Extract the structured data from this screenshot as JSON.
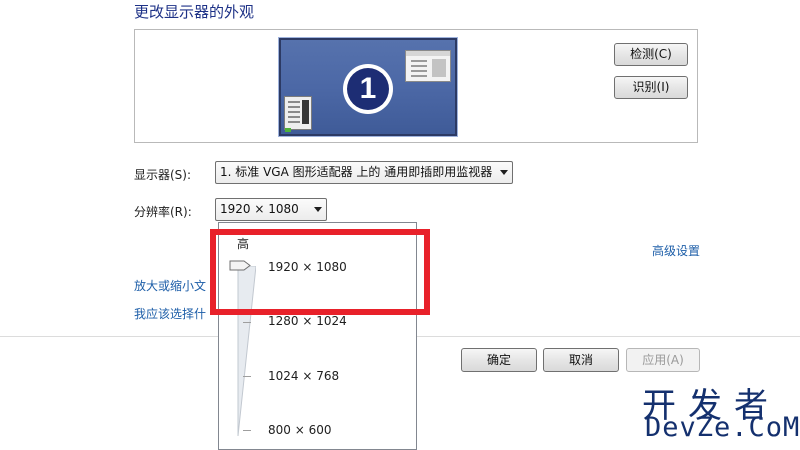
{
  "header": {
    "title": "更改显示器的外观"
  },
  "preview": {
    "monitor_number": "1",
    "detect_button": "检测(C)",
    "identify_button": "识别(I)"
  },
  "settings": {
    "display_label": "显示器(S):",
    "display_value": "1. 标准 VGA 图形适配器 上的 通用即插即用监视器",
    "resolution_label": "分辨率(R):",
    "resolution_value": "1920 × 1080",
    "advanced_link": "高级设置",
    "zoom_link": "放大或缩小文",
    "which_link": "我应该选择什"
  },
  "resolution_dropdown": {
    "high_label": "高",
    "options": [
      "1920 × 1080",
      "1280 × 1024",
      "1024 × 768",
      "800 × 600"
    ],
    "selected": "1920 × 1080"
  },
  "footer": {
    "ok_button": "确定",
    "cancel_button": "取消",
    "apply_button": "应用(A)"
  },
  "watermark": {
    "line1": "开发者",
    "line2": "DevZe.CoM"
  },
  "colors": {
    "highlight": "#e8212a",
    "link": "#1d5ea8",
    "heading": "#1e3287"
  }
}
